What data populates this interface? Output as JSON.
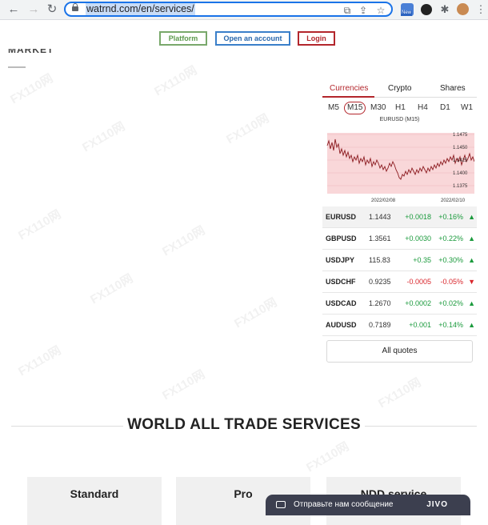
{
  "browser": {
    "url": "watrnd.com/en/services/",
    "extension_badge": "New"
  },
  "header": {
    "platform_label": "Platform",
    "open_account_label": "Open an account",
    "login_label": "Login",
    "partial_heading": "MARKET QUOTES"
  },
  "quotes": {
    "tabs": [
      "Currencies",
      "Crypto",
      "Shares"
    ],
    "active_tab": "Currencies",
    "timeframes": [
      "M5",
      "M15",
      "M30",
      "H1",
      "H4",
      "D1",
      "W1"
    ],
    "active_timeframe": "M15",
    "chart_title": "EURUSD (M15)",
    "chart_y_ticks": [
      "1.1475",
      "1.1450",
      "1.1425",
      "1.1400",
      "1.1375"
    ],
    "chart_x_ticks": [
      "2022/02/08",
      "2022/02/10"
    ],
    "rows": [
      {
        "symbol": "EURUSD",
        "price": "1.1443",
        "change": "+0.0018",
        "percent": "+0.16%",
        "dir": "up"
      },
      {
        "symbol": "GBPUSD",
        "price": "1.3561",
        "change": "+0.0030",
        "percent": "+0.22%",
        "dir": "up"
      },
      {
        "symbol": "USDJPY",
        "price": "115.83",
        "change": "+0.35",
        "percent": "+0.30%",
        "dir": "up"
      },
      {
        "symbol": "USDCHF",
        "price": "0.9235",
        "change": "-0.0005",
        "percent": "-0.05%",
        "dir": "down"
      },
      {
        "symbol": "USDCAD",
        "price": "1.2670",
        "change": "+0.0002",
        "percent": "+0.02%",
        "dir": "up"
      },
      {
        "symbol": "AUDUSD",
        "price": "0.7189",
        "change": "+0.001",
        "percent": "+0.14%",
        "dir": "up"
      }
    ],
    "all_quotes_label": "All quotes"
  },
  "section": {
    "title": "WORLD ALL TRADE SERVICES"
  },
  "cards": [
    "Standard",
    "Pro",
    "NDD service"
  ],
  "chat": {
    "text": "Отправьте нам сообщение",
    "brand": "JIVO"
  },
  "watermark": "FX110网",
  "colors": {
    "accent_red": "#b3262c",
    "up_green": "#1a9a3c",
    "platform_green": "#79a86b",
    "account_blue": "#3a7fc9"
  }
}
